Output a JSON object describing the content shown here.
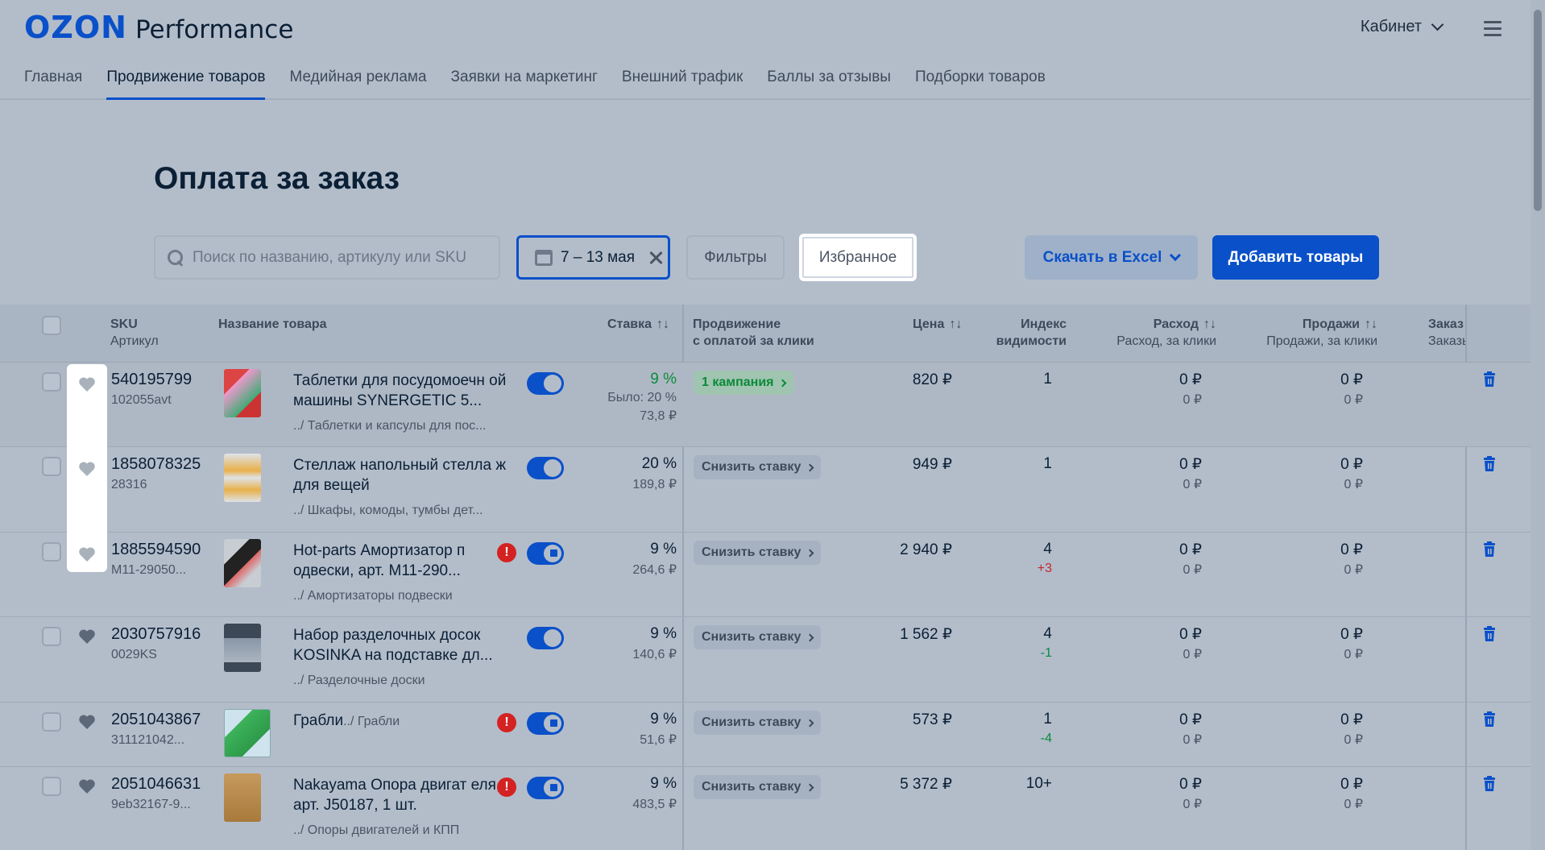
{
  "header": {
    "logo_brand": "OZON",
    "logo_product": "Performance",
    "cabinet_label": "Кабинет"
  },
  "nav": {
    "items": [
      {
        "label": "Главная",
        "active": false
      },
      {
        "label": "Продвижение товаров",
        "active": true
      },
      {
        "label": "Медийная реклама",
        "active": false
      },
      {
        "label": "Заявки на маркетинг",
        "active": false
      },
      {
        "label": "Внешний трафик",
        "active": false
      },
      {
        "label": "Баллы за отзывы",
        "active": false
      },
      {
        "label": "Подборки товаров",
        "active": false
      }
    ]
  },
  "page": {
    "title": "Оплата за заказ"
  },
  "toolbar": {
    "search_placeholder": "Поиск по названию, артикулу или SKU",
    "date_range": "7 – 13 мая",
    "filters_label": "Фильтры",
    "favorites_label": "Избранное",
    "excel_label": "Скачать в Excel",
    "add_label": "Добавить товары"
  },
  "columns": {
    "sku": "SKU",
    "article": "Артикул",
    "name": "Название товара",
    "rate": "Ставка",
    "promo_1": "Продвижение",
    "promo_2": "с оплатой за клики",
    "price": "Цена",
    "vis_1": "Индекс",
    "vis_2": "видимости",
    "spend": "Расход",
    "spend_sub": "Расход, за клики",
    "sales": "Продажи",
    "sales_sub": "Продажи, за клики",
    "orders": "Заказ",
    "orders_sub": "Заказы,"
  },
  "rows": [
    {
      "sku": "540195799",
      "article": "102055avt",
      "name": "Таблетки для посудомоечн ой машины SYNERGETIC 5...",
      "category": "../ Таблетки и капсулы для пос...",
      "warning": false,
      "locked": false,
      "rate": "9 %",
      "rate_green": true,
      "rate_was": "Было: 20 %",
      "rate_rub": "73,8 ₽",
      "promo": "1 кампания",
      "promo_green": true,
      "price": "820 ₽",
      "visibility": "1",
      "visibility_delta": "",
      "spend": "0 ₽",
      "spend_clicks": "0 ₽",
      "sales": "0 ₽",
      "sales_clicks": "0 ₽"
    },
    {
      "sku": "1858078325",
      "article": "28316",
      "name": "Стеллаж напольный стелла ж для вещей",
      "category": "../ Шкафы, комоды, тумбы дет...",
      "warning": false,
      "locked": false,
      "rate": "20 %",
      "rate_green": false,
      "rate_was": "",
      "rate_rub": "189,8 ₽",
      "promo": "Снизить ставку",
      "promo_green": false,
      "price": "949 ₽",
      "visibility": "1",
      "visibility_delta": "",
      "spend": "0 ₽",
      "spend_clicks": "0 ₽",
      "sales": "0 ₽",
      "sales_clicks": "0 ₽"
    },
    {
      "sku": "1885594590",
      "article": "M11-29050...",
      "name": "Hot-parts Амортизатор п одвески, арт. M11-290...",
      "category": "../ Амортизаторы подвески",
      "warning": true,
      "locked": true,
      "rate": "9 %",
      "rate_green": false,
      "rate_was": "",
      "rate_rub": "264,6 ₽",
      "promo": "Снизить ставку",
      "promo_green": false,
      "price": "2 940 ₽",
      "visibility": "4",
      "visibility_delta": "+3",
      "spend": "0 ₽",
      "spend_clicks": "0 ₽",
      "sales": "0 ₽",
      "sales_clicks": "0 ₽"
    },
    {
      "sku": "2030757916",
      "article": "0029KS",
      "name": "Набор разделочных досок KOSINKA на подставке дл...",
      "category": "../ Разделочные доски",
      "warning": false,
      "locked": false,
      "rate": "9 %",
      "rate_green": false,
      "rate_was": "",
      "rate_rub": "140,6 ₽",
      "promo": "Снизить ставку",
      "promo_green": false,
      "price": "1 562 ₽",
      "visibility": "4",
      "visibility_delta": "-1",
      "spend": "0 ₽",
      "spend_clicks": "0 ₽",
      "sales": "0 ₽",
      "sales_clicks": "0 ₽"
    },
    {
      "sku": "2051043867",
      "article": "311121042...",
      "name": "Грабли",
      "category": "../ Грабли",
      "warning": true,
      "locked": true,
      "rate": "9 %",
      "rate_green": false,
      "rate_was": "",
      "rate_rub": "51,6 ₽",
      "promo": "Снизить ставку",
      "promo_green": false,
      "price": "573 ₽",
      "visibility": "1",
      "visibility_delta": "-4",
      "spend": "0 ₽",
      "spend_clicks": "0 ₽",
      "sales": "0 ₽",
      "sales_clicks": "0 ₽"
    },
    {
      "sku": "2051046631",
      "article": "9eb32167-9...",
      "name": "Nakayama Опора двигат еля, арт. J50187, 1 шт.",
      "category": "../ Опоры двигателей и КПП",
      "warning": true,
      "locked": true,
      "rate": "9 %",
      "rate_green": false,
      "rate_was": "",
      "rate_rub": "483,5 ₽",
      "promo": "Снизить ставку",
      "promo_green": false,
      "price": "5 372 ₽",
      "visibility": "10+",
      "visibility_delta": "",
      "spend": "0 ₽",
      "spend_clicks": "0 ₽",
      "sales": "0 ₽",
      "sales_clicks": "0 ₽"
    }
  ]
}
